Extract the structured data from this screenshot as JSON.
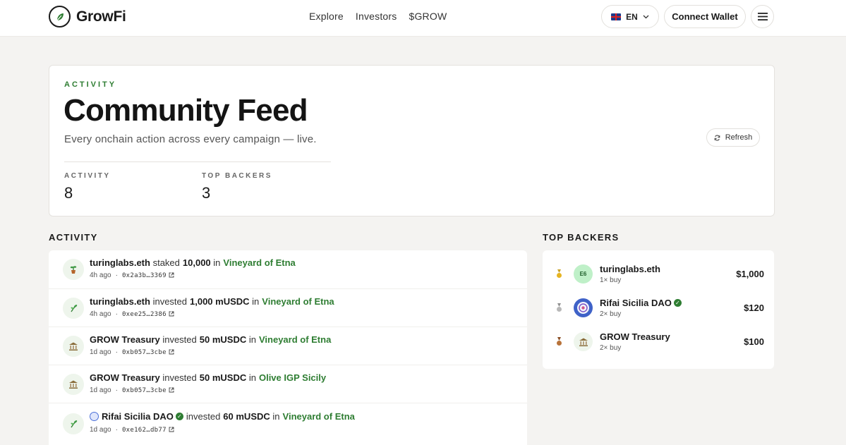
{
  "header": {
    "brand": "GrowFi",
    "nav": [
      "Explore",
      "Investors",
      "$GROW"
    ],
    "language": "EN",
    "connect_label": "Connect Wallet"
  },
  "hero": {
    "eyebrow": "ACTIVITY",
    "title": "Community Feed",
    "subtitle": "Every onchain action across every campaign — live.",
    "refresh_label": "Refresh",
    "stats": [
      {
        "label": "ACTIVITY",
        "value": "8"
      },
      {
        "label": "TOP BACKERS",
        "value": "3"
      }
    ]
  },
  "activity": {
    "title": "ACTIVITY",
    "items": [
      {
        "icon": "potted-plant-icon",
        "actor": "turinglabs.eth",
        "verb": "staked",
        "amount": "10,000",
        "prep": "in",
        "campaign": "Vineyard of Etna",
        "time": "4h ago",
        "tx": "0x2a3b…3369"
      },
      {
        "icon": "sprout-icon",
        "actor": "turinglabs.eth",
        "verb": "invested",
        "amount": "1,000 mUSDC",
        "prep": "in",
        "campaign": "Vineyard of Etna",
        "time": "4h ago",
        "tx": "0xee25…2386"
      },
      {
        "icon": "bank-icon",
        "actor": "GROW Treasury",
        "verb": "invested",
        "amount": "50 mUSDC",
        "prep": "in",
        "campaign": "Vineyard of Etna",
        "time": "1d ago",
        "tx": "0xb057…3cbe"
      },
      {
        "icon": "bank-icon",
        "actor": "GROW Treasury",
        "verb": "invested",
        "amount": "50 mUSDC",
        "prep": "in",
        "campaign": "Olive IGP Sicily",
        "time": "1d ago",
        "tx": "0xb057…3cbe"
      },
      {
        "icon": "sprout-icon",
        "actor": "Rifai Sicilia DAO",
        "verb": "invested",
        "amount": "60 mUSDC",
        "prep": "in",
        "campaign": "Vineyard of Etna",
        "time": "1d ago",
        "tx": "0xe162…db77"
      }
    ]
  },
  "backers": {
    "title": "TOP BACKERS",
    "items": [
      {
        "medal": "gold-medal-icon",
        "initials": "E6",
        "name": "turinglabs.eth",
        "sub": "1× buy",
        "amount": "$1,000"
      },
      {
        "medal": "silver-medal-icon",
        "initials": "",
        "name": "Rifai Sicilia DAO",
        "sub": "2× buy",
        "amount": "$120"
      },
      {
        "medal": "bronze-medal-icon",
        "initials": "",
        "name": "GROW Treasury",
        "sub": "2× buy",
        "amount": "$100"
      }
    ]
  },
  "colors": {
    "accent_green": "#2e7d32",
    "background": "#f4f3f1",
    "card": "#ffffff"
  }
}
